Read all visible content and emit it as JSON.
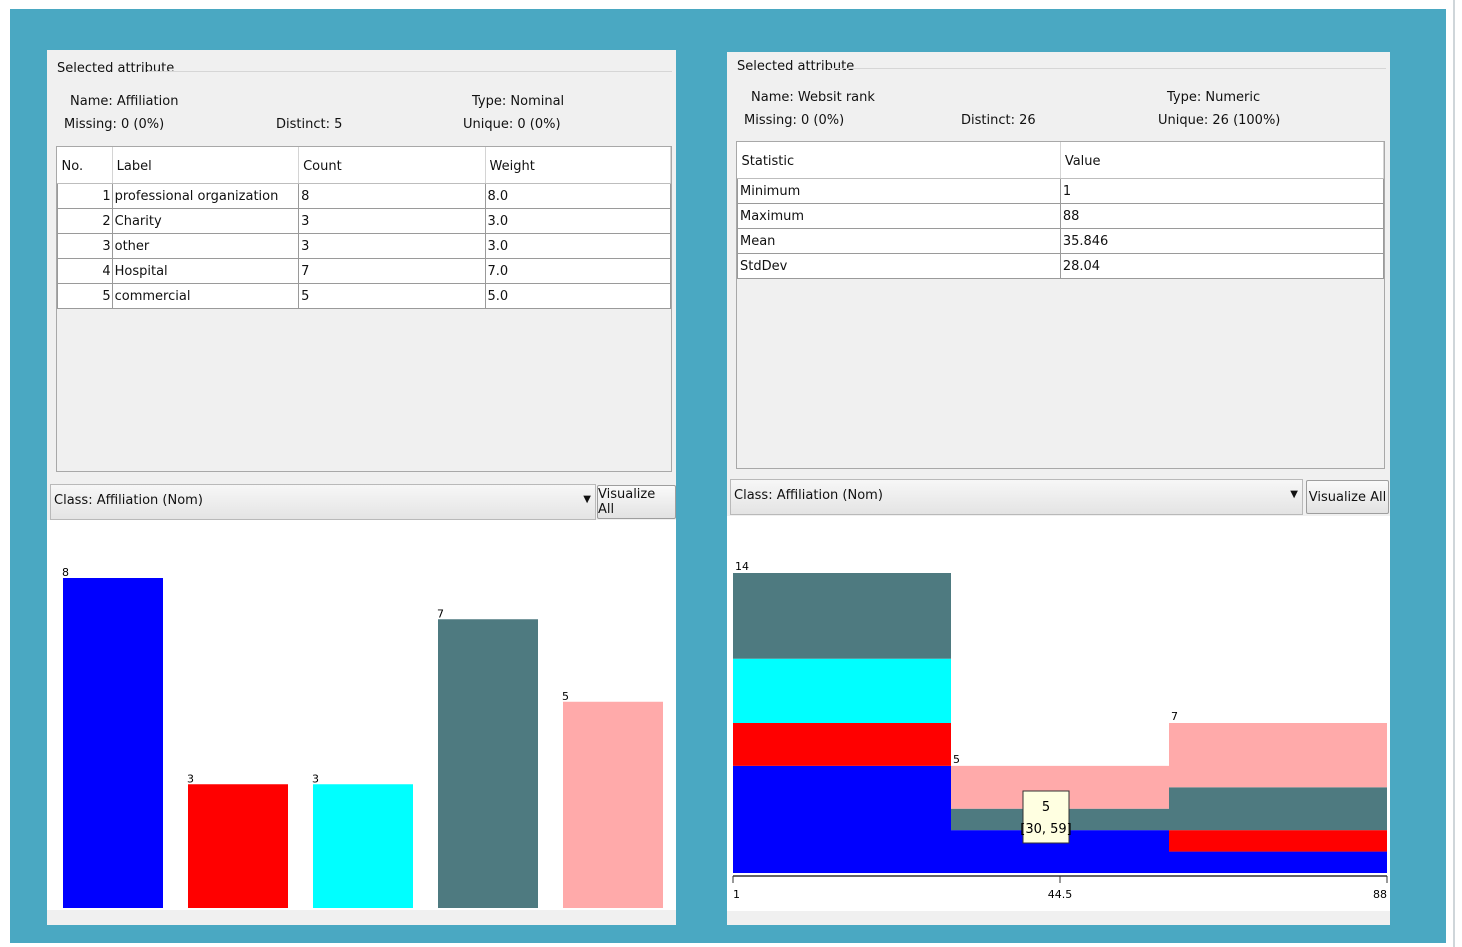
{
  "left_panel": {
    "section_title": "Selected attribute",
    "name_label": "Name:",
    "name_value": "Affiliation",
    "type_label": "Type:",
    "type_value": "Nominal",
    "missing_label": "Missing:",
    "missing_value": "0 (0%)",
    "distinct_label": "Distinct:",
    "distinct_value": "5",
    "unique_label": "Unique:",
    "unique_value": "0 (0%)",
    "table": {
      "headers": [
        "No.",
        "Label",
        "Count",
        "Weight"
      ],
      "rows": [
        [
          "1",
          "professional organization",
          "8",
          "8.0"
        ],
        [
          "2",
          "Charity",
          "3",
          "3.0"
        ],
        [
          "3",
          "other",
          "3",
          "3.0"
        ],
        [
          "4",
          "Hospital",
          "7",
          "7.0"
        ],
        [
          "5",
          "commercial",
          "5",
          "5.0"
        ]
      ]
    },
    "class_select": "Class: Affiliation (Nom)",
    "visualize_button": "Visualize All"
  },
  "right_panel": {
    "section_title": "Selected attribute",
    "name_label": "Name:",
    "name_value": "Websit rank",
    "type_label": "Type:",
    "type_value": "Numeric",
    "missing_label": "Missing:",
    "missing_value": "0 (0%)",
    "distinct_label": "Distinct:",
    "distinct_value": "26",
    "unique_label": "Unique:",
    "unique_value": "26 (100%)",
    "table": {
      "headers": [
        "Statistic",
        "Value"
      ],
      "rows": [
        [
          "Minimum",
          "1"
        ],
        [
          "Maximum",
          "88"
        ],
        [
          "Mean",
          "35.846"
        ],
        [
          "StdDev",
          "28.04"
        ]
      ]
    },
    "class_select": "Class: Affiliation (Nom)",
    "visualize_button": "Visualize All"
  },
  "colors": {
    "professional organization": "#0000ff",
    "Charity": "#ff0000",
    "other": "#00ffff",
    "Hospital": "#4e7a80",
    "commercial": "#ffaaaa"
  },
  "chart_data": [
    {
      "type": "bar",
      "categories": [
        "professional organization",
        "Charity",
        "other",
        "Hospital",
        "commercial"
      ],
      "values": [
        8,
        3,
        3,
        7,
        5
      ],
      "value_labels": [
        "8",
        "3",
        "3",
        "7",
        "5"
      ],
      "ylim": [
        0,
        8
      ]
    },
    {
      "type": "bar",
      "stacked": true,
      "x_ticks": [
        "1",
        "44.5",
        "88"
      ],
      "xlim": [
        1,
        88
      ],
      "bins": [
        {
          "total": 14,
          "total_label": "14",
          "segments": {
            "professional organization": 5,
            "Charity": 2,
            "other": 3,
            "Hospital": 4,
            "commercial": 0
          }
        },
        {
          "total": 5,
          "total_label": "5",
          "segments": {
            "professional organization": 2,
            "Charity": 0,
            "other": 0,
            "Hospital": 1,
            "commercial": 2
          }
        },
        {
          "total": 7,
          "total_label": "7",
          "segments": {
            "professional organization": 1,
            "Charity": 1,
            "other": 0,
            "Hospital": 2,
            "commercial": 3
          }
        }
      ],
      "tooltip": {
        "count": "5",
        "range": "[30, 59]"
      },
      "ylim": [
        0,
        14
      ]
    }
  ]
}
